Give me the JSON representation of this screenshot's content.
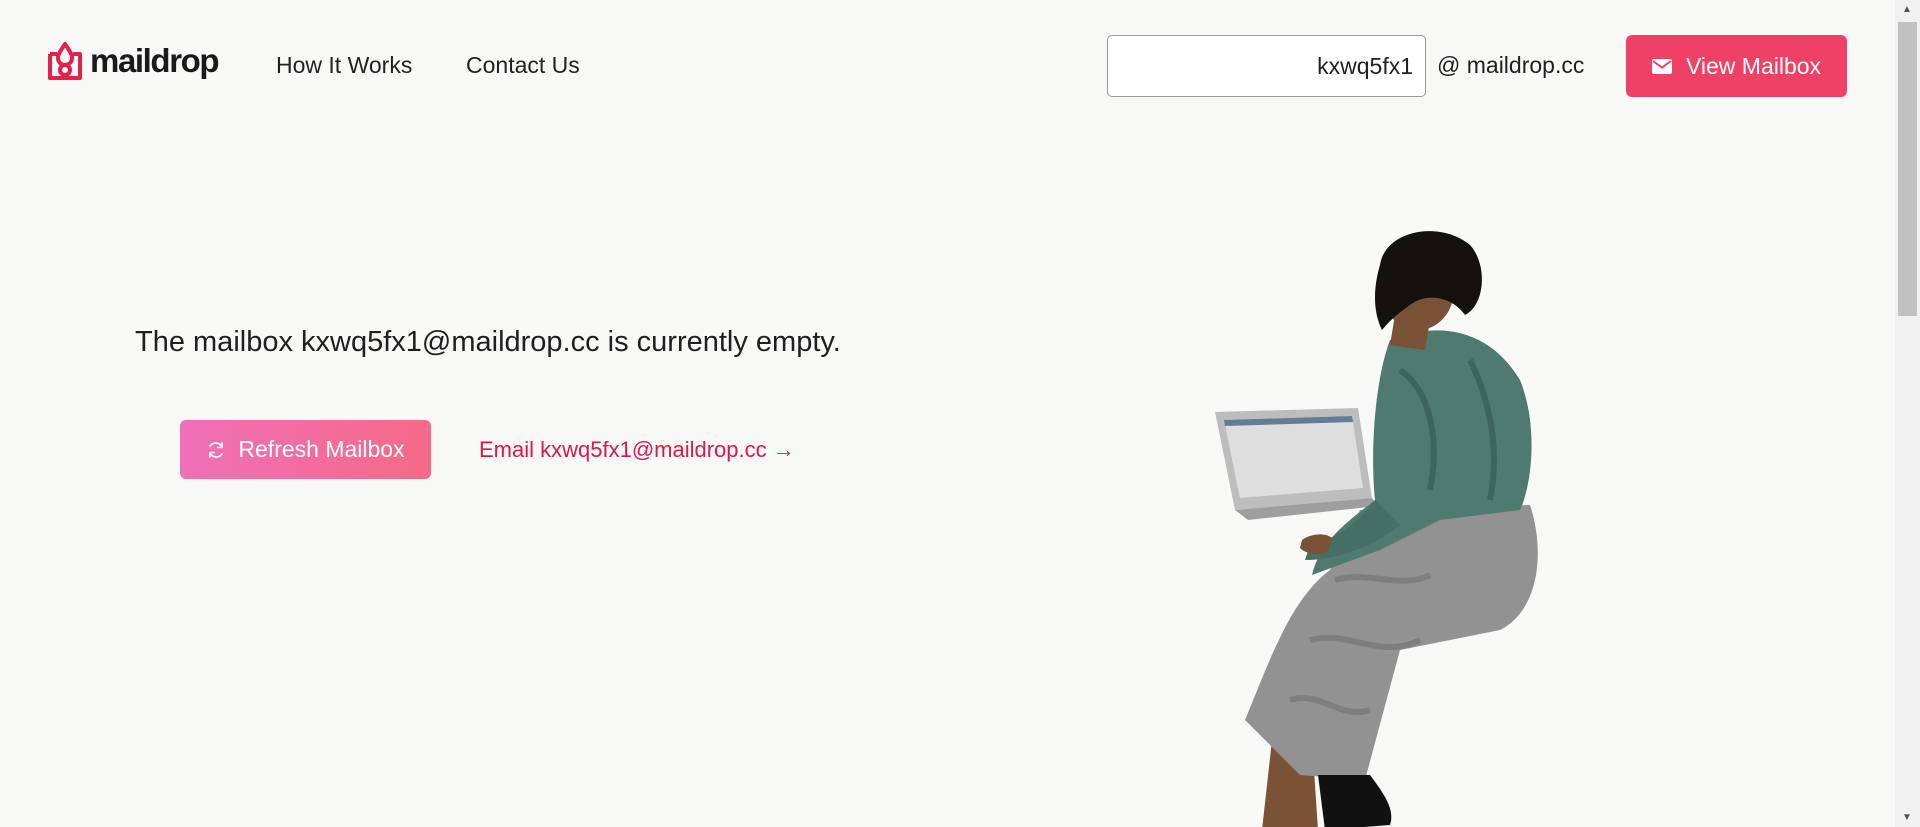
{
  "header": {
    "logo_text": "maildrop",
    "nav": [
      {
        "label": "How It Works"
      },
      {
        "label": "Contact Us"
      }
    ],
    "mailbox_input_value": "kxwq5fx1",
    "domain_suffix": "@ maildrop.cc",
    "view_button_label": "View Mailbox"
  },
  "main": {
    "empty_message": "The mailbox kxwq5fx1@maildrop.cc is currently empty.",
    "refresh_button_label": "Refresh Mailbox",
    "email_link_label": "Email kxwq5fx1@maildrop.cc →"
  },
  "icons": {
    "logo": "maildrop-logo-icon",
    "view_button": "envelope-icon",
    "refresh_button": "refresh-icon"
  },
  "colors": {
    "brand": "#ef4165",
    "link": "#d9194b",
    "refresh_gradient_start": "#f06fb9",
    "refresh_gradient_end": "#f56a86",
    "background": "#f8f8f7"
  }
}
